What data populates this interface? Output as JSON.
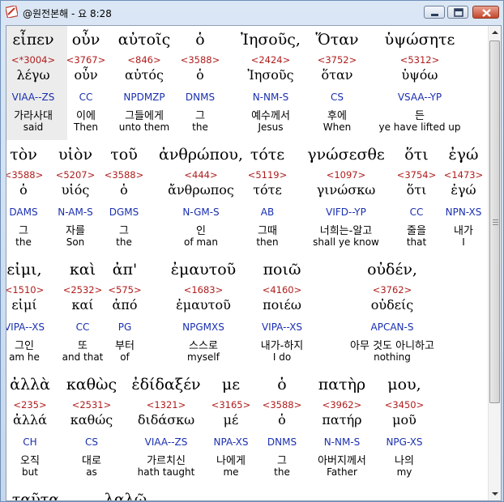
{
  "window": {
    "title": "@원전본해 - 요 8:28",
    "buttons": {
      "minimize": "minimize",
      "maximize": "maximize",
      "close": "close"
    }
  },
  "lines": [
    {
      "words": [
        {
          "greek": "εἶπεν",
          "strong": "<*3004>",
          "lemma": "λέγω",
          "parsing": "VIAA--ZS",
          "korean": "가라사대",
          "english": "said"
        },
        {
          "greek": "οὖν",
          "strong": "<3767>",
          "lemma": "οὖν",
          "parsing": "CC",
          "korean": "이에",
          "english": "Then"
        },
        {
          "greek": "αὐτοῖς",
          "strong": "<846>",
          "lemma": "αὐτός",
          "parsing": "NPDMZP",
          "korean": "그들에게",
          "english": "unto them"
        },
        {
          "greek": "ὁ",
          "strong": "<3588>",
          "lemma": "ὁ",
          "parsing": "DNMS",
          "korean": "그",
          "english": "the"
        },
        {
          "greek": "Ἰησοῦς,",
          "strong": "<2424>",
          "lemma": "Ἰησοῦς",
          "parsing": "N-NM-S",
          "korean": "예수께서",
          "english": "Jesus"
        },
        {
          "greek": "Ὅταν",
          "strong": "<3752>",
          "lemma": "ὅταν",
          "parsing": "CS",
          "korean": "후에",
          "english": "When"
        },
        {
          "greek": "ὑψώσητε",
          "strong": "<5312>",
          "lemma": "ὑψόω",
          "parsing": "VSAA--YP",
          "korean": "든",
          "english": "ye have lifted up"
        }
      ]
    },
    {
      "words": [
        {
          "greek": "τὸν",
          "strong": "<3588>",
          "lemma": "ὁ",
          "parsing": "DAMS",
          "korean": "그",
          "english": "the"
        },
        {
          "greek": "υἱὸν",
          "strong": "<5207>",
          "lemma": "υἱός",
          "parsing": "N-AM-S",
          "korean": "자를",
          "english": "Son"
        },
        {
          "greek": "τοῦ",
          "strong": "<3588>",
          "lemma": "ὁ",
          "parsing": "DGMS",
          "korean": "그",
          "english": "the"
        },
        {
          "greek": "ἀνθρώπου,",
          "strong": "<444>",
          "lemma": "ἄνθρωπος",
          "parsing": "N-GM-S",
          "korean": "인",
          "english": "of man"
        },
        {
          "greek": "τότε",
          "strong": "<5119>",
          "lemma": "τότε",
          "parsing": "AB",
          "korean": "그때",
          "english": "then"
        },
        {
          "greek": "γνώσεσθε",
          "strong": "<1097>",
          "lemma": "γινώσκω",
          "parsing": "VIFD--YP",
          "korean": "너희는-알고",
          "english": "shall ye know"
        },
        {
          "greek": "ὅτι",
          "strong": "<3754>",
          "lemma": "ὅτι",
          "parsing": "CC",
          "korean": "줄을",
          "english": "that"
        },
        {
          "greek": "ἐγώ",
          "strong": "<1473>",
          "lemma": "ἐγώ",
          "parsing": "NPN-XS",
          "korean": "내가",
          "english": "I"
        }
      ]
    },
    {
      "words": [
        {
          "greek": "εἰμι,",
          "strong": "<1510>",
          "lemma": "εἰμί",
          "parsing": "VIPA--XS",
          "korean": "그인",
          "english": "am he"
        },
        {
          "greek": "καὶ",
          "strong": "<2532>",
          "lemma": "καί",
          "parsing": "CC",
          "korean": "또",
          "english": "and that"
        },
        {
          "greek": "ἀπ'",
          "strong": "<575>",
          "lemma": "ἀπό",
          "parsing": "PG",
          "korean": "부터",
          "english": "of"
        },
        {
          "greek": "ἐμαυτοῦ",
          "strong": "<1683>",
          "lemma": "ἐμαυτοῦ",
          "parsing": "NPGMXS",
          "korean": "스스로",
          "english": "myself"
        },
        {
          "greek": "ποιῶ",
          "strong": "<4160>",
          "lemma": "ποιέω",
          "parsing": "VIPA--XS",
          "korean": "내가-하지",
          "english": "I do"
        },
        {
          "greek": "οὐδέν,",
          "strong": "<3762>",
          "lemma": "οὐδείς",
          "parsing": "APCAN-S",
          "korean": "아무 것도 아니하고",
          "english": "nothing"
        }
      ]
    },
    {
      "words": [
        {
          "greek": "ἀλλὰ",
          "strong": "<235>",
          "lemma": "ἀλλά",
          "parsing": "CH",
          "korean": "오직",
          "english": "but"
        },
        {
          "greek": "καθὼς",
          "strong": "<2531>",
          "lemma": "καθώς",
          "parsing": "CS",
          "korean": "대로",
          "english": "as"
        },
        {
          "greek": "ἐδίδαξέν",
          "strong": "<1321>",
          "lemma": "διδάσκω",
          "parsing": "VIAA--ZS",
          "korean": "가르치신",
          "english": "hath taught"
        },
        {
          "greek": "με",
          "strong": "<3165>",
          "lemma": "μέ",
          "parsing": "NPA-XS",
          "korean": "나에게",
          "english": "me"
        },
        {
          "greek": "ὁ",
          "strong": "<3588>",
          "lemma": "ὁ",
          "parsing": "DNMS",
          "korean": "그",
          "english": "the"
        },
        {
          "greek": "πατὴρ",
          "strong": "<3962>",
          "lemma": "πατήρ",
          "parsing": "N-NM-S",
          "korean": "아버지께서",
          "english": "Father"
        },
        {
          "greek": "μου,",
          "strong": "<3450>",
          "lemma": "μοῦ",
          "parsing": "NPG-XS",
          "korean": "나의",
          "english": "my"
        }
      ]
    },
    {
      "words": [
        {
          "greek": "ταῦτα"
        },
        {
          "greek": "λαλῶ"
        }
      ]
    }
  ]
}
